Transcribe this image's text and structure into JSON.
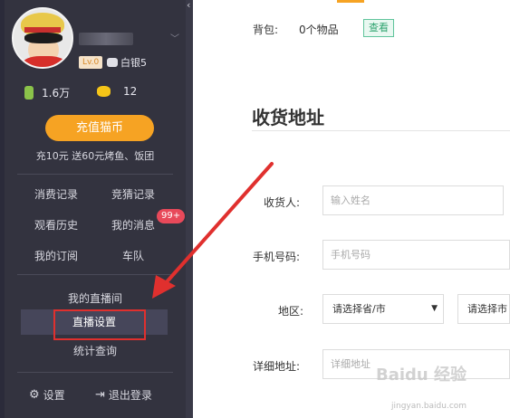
{
  "sidebar": {
    "level": "Lv.0",
    "bag_badge": "白银5",
    "bamboo_count": "1.6万",
    "coin_count": "12",
    "recharge_label": "充值猫币",
    "promo": "充10元 送60元烤鱼、饭团",
    "menu": {
      "consume": "消费记录",
      "quiz": "竞猜记录",
      "history": "观看历史",
      "messages": "我的消息",
      "messages_badge": "99+",
      "subscriptions": "我的订阅",
      "team": "车队"
    },
    "live": {
      "room": "我的直播间",
      "settings": "直播设置",
      "stats": "统计查询"
    },
    "bottom": {
      "settings": "设置",
      "logout": "退出登录"
    }
  },
  "main": {
    "bag_label": "背包:",
    "bag_count": "0个物品",
    "view_button": "查看",
    "section_title": "收货地址",
    "form": {
      "receiver_label": "收货人:",
      "receiver_placeholder": "输入姓名",
      "phone_label": "手机号码:",
      "phone_placeholder": "手机号码",
      "region_label": "地区:",
      "province_select": "请选择省/市",
      "city_select": "请选择市",
      "address_label": "详细地址:",
      "address_placeholder": "详细地址"
    }
  },
  "watermark": {
    "brand": "Baidu 经验",
    "url": "jingyan.baidu.com"
  },
  "colors": {
    "panel_bg": "#33333f",
    "accent_orange": "#f6a323",
    "badge_red": "#e8495a",
    "highlight_red": "#e0302e",
    "green": "#2fa36f"
  }
}
